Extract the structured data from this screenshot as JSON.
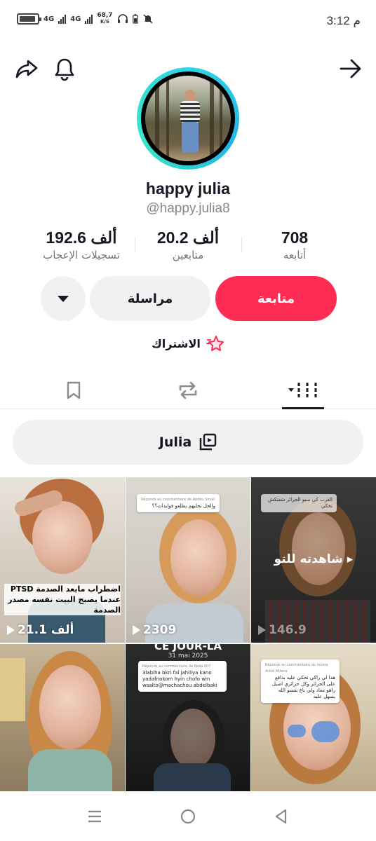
{
  "status_bar": {
    "network_1": "4G",
    "network_2": "4G",
    "speed_value": "68,7",
    "speed_unit": "K/S",
    "time": "3:12 م"
  },
  "top_bar": {
    "share_icon": "share-arrow-icon",
    "bell_icon": "bell-icon",
    "back_icon": "arrow-right-icon"
  },
  "profile": {
    "display_name": "happy julia",
    "username": "@happy.julia8"
  },
  "stats": [
    {
      "value": "192.6 ألف",
      "label": "تسجيلات الإعجاب"
    },
    {
      "value": "20.2 ألف",
      "label": "متابعين"
    },
    {
      "value": "708",
      "label": "أتابعه"
    }
  ],
  "actions": {
    "follow": "متابعة",
    "message": "مراسلة"
  },
  "subscribe": {
    "label": "الاشتراك"
  },
  "tabs": [
    "saved",
    "reposts",
    "videos"
  ],
  "playlist": {
    "label": "Julia"
  },
  "videos": [
    {
      "views": "21.1 ألف",
      "caption": "اضطراب مابعد الصدمة PTSD عندما يصبح البيت نفسه مصدر الصدمة"
    },
    {
      "views": "2309",
      "comment_header": "Réponds au commentaire de Abdou Smail",
      "comment": "والحل تخليهم يطلعو فوايدات؟؟"
    },
    {
      "views": "146.9",
      "comment": "الغرب كي سبو الجزائر شفتكش تحكي",
      "badge": "شاهدته للتو"
    },
    {
      "banner_title": "CE JOUR-LA",
      "banner_date": "31 mai 2025",
      "comment_header": "Réponds au commentaire de Reda.007",
      "comment": "3labiha bkri fal jahiliya kano yadafnokom hyin chofo win wsalto@machachou abdelbaki"
    },
    {
      "comment_header": "Réponds au commentaire de moma Artist Milena",
      "comment": "هذا لي راكي تحكي عليه بدافع على الجزائر وكل جزائري اصيل راهو معاد ولي باغ نفسو الله يسهل عليه"
    }
  ],
  "colors": {
    "follow_red": "#fe2c55",
    "ring_cyan": "#2fd4e6",
    "neutral_btn": "#f1f1f2"
  }
}
